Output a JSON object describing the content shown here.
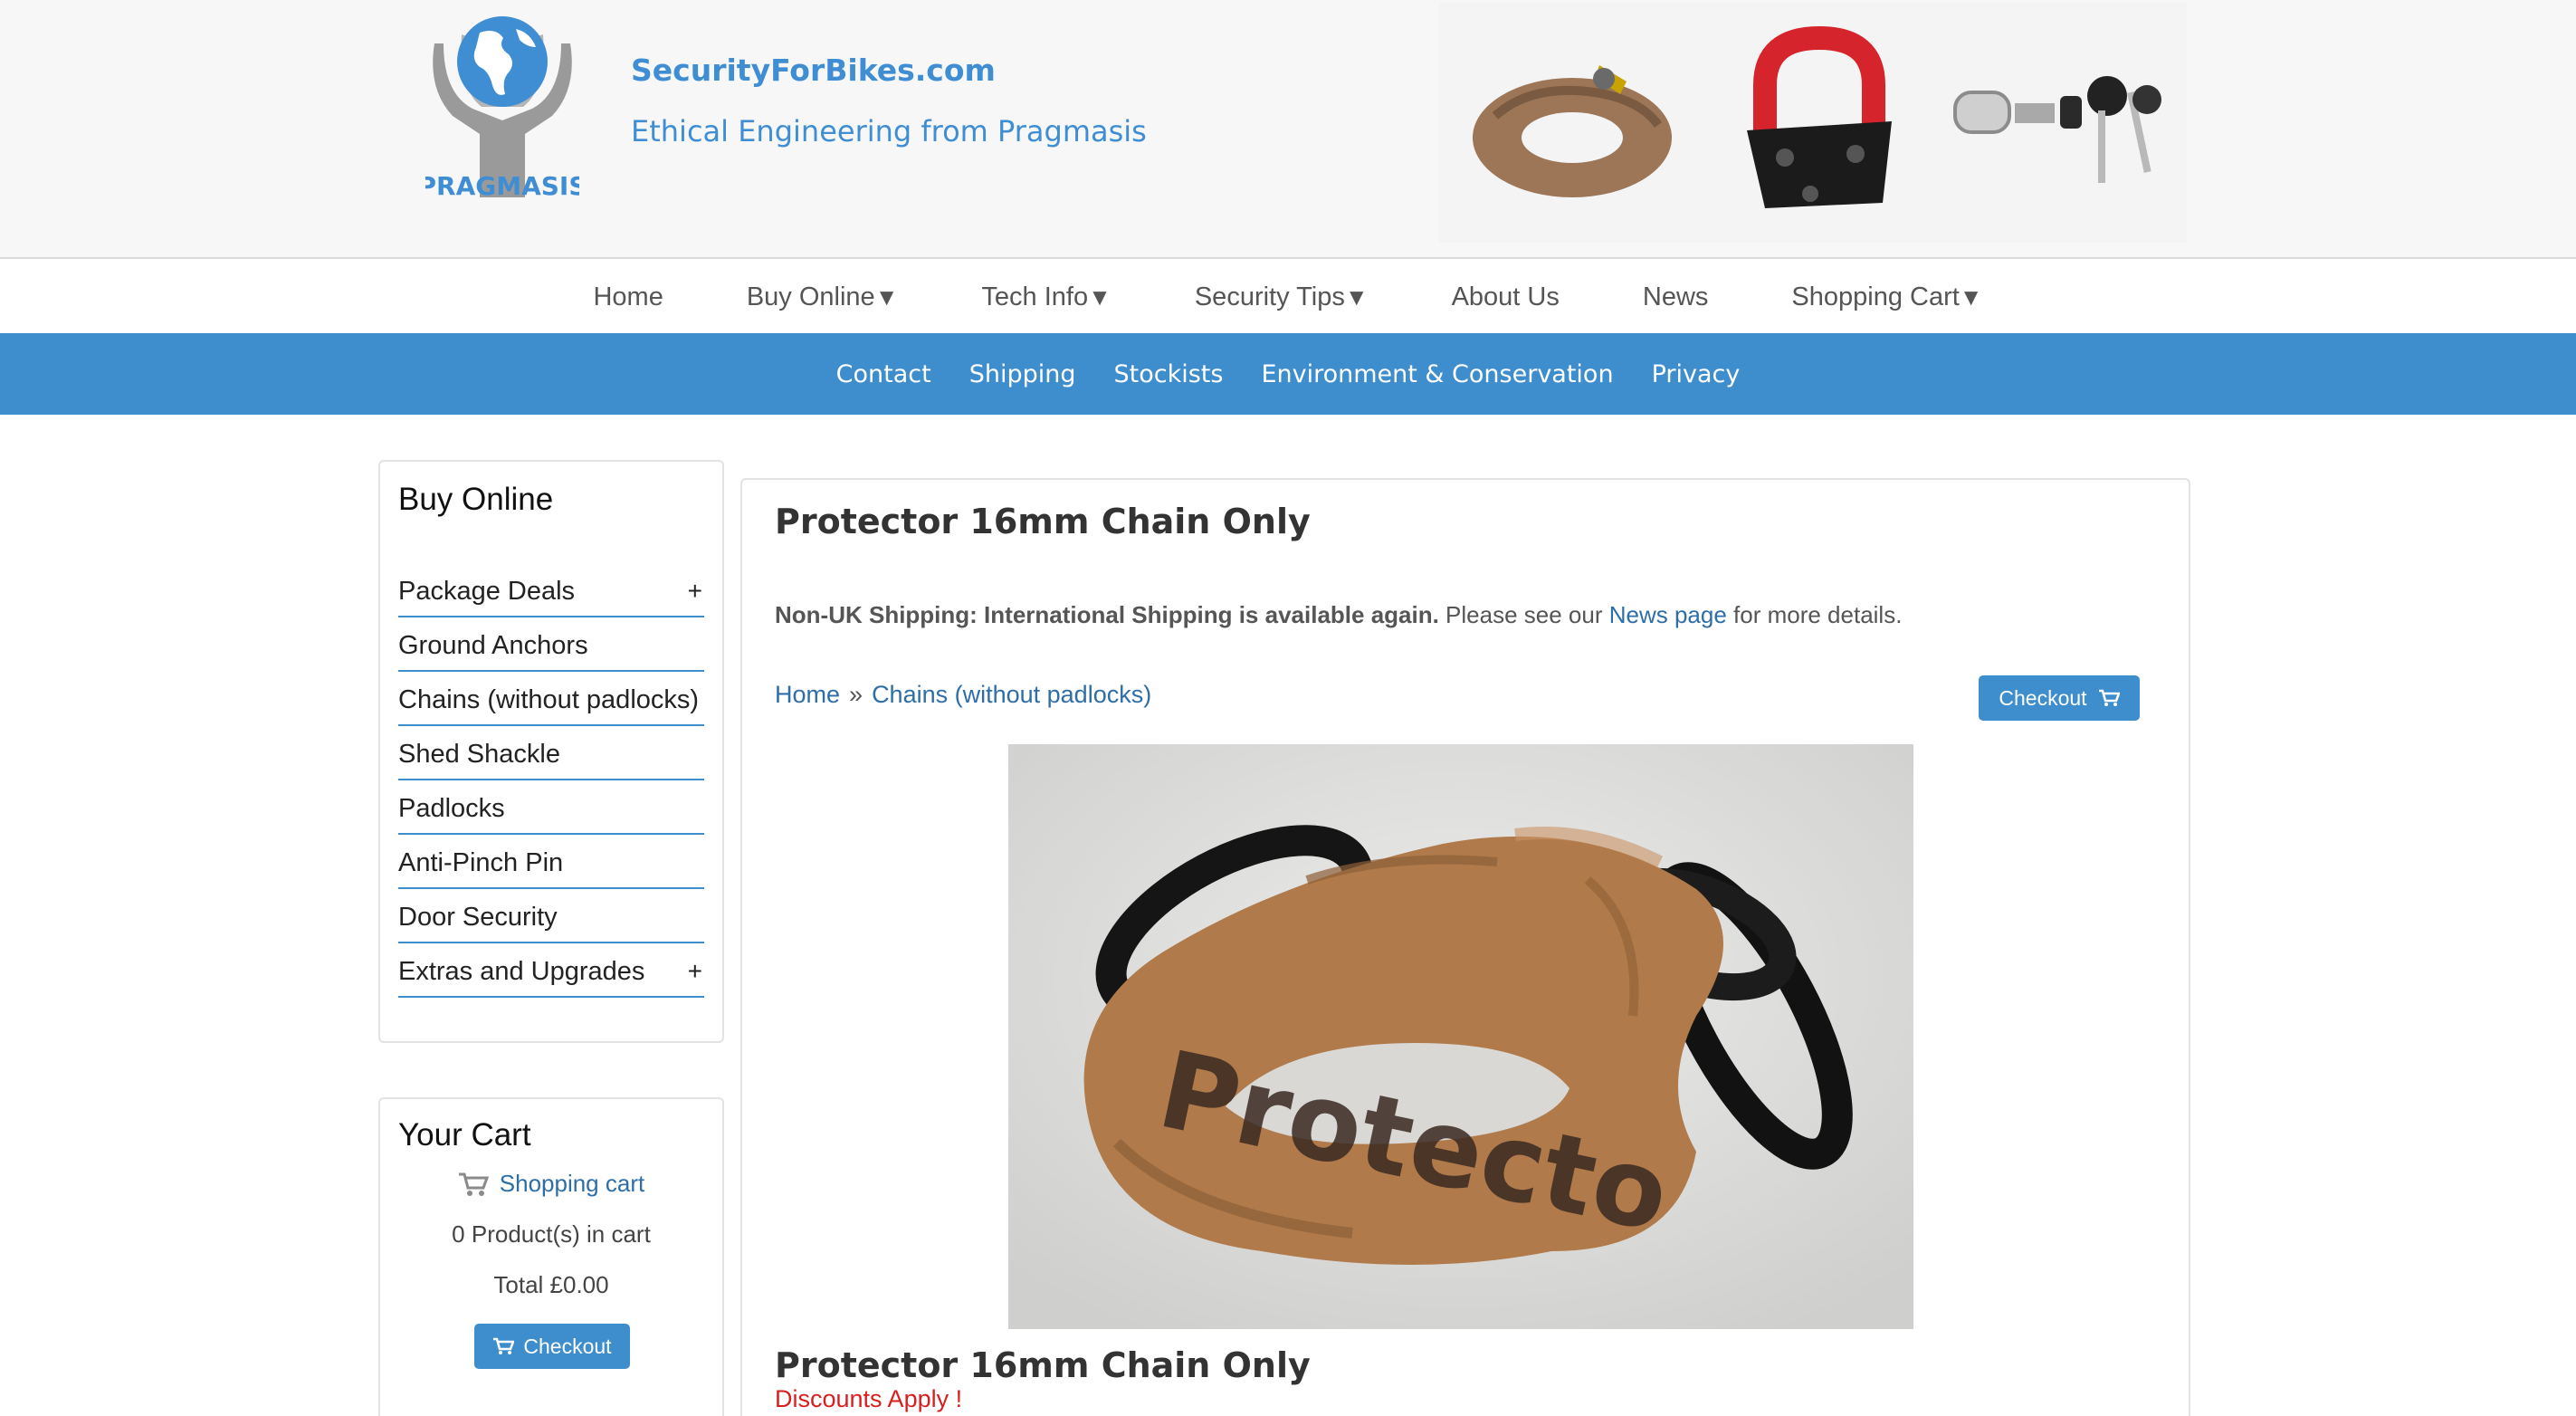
{
  "header": {
    "site_name": "SecurityForBikes.com",
    "tagline": "Ethical Engineering from Pragmasis",
    "logo_text": "PRAGMASIS"
  },
  "main_nav": [
    {
      "label": "Home",
      "dropdown": false
    },
    {
      "label": "Buy Online",
      "dropdown": true
    },
    {
      "label": "Tech Info",
      "dropdown": true
    },
    {
      "label": "Security Tips",
      "dropdown": true
    },
    {
      "label": "About Us",
      "dropdown": false
    },
    {
      "label": "News",
      "dropdown": false
    },
    {
      "label": "Shopping Cart",
      "dropdown": true
    }
  ],
  "dropdown_caret": "▼",
  "sub_nav": [
    "Contact",
    "Shipping",
    "Stockists",
    "Environment & Conservation",
    "Privacy"
  ],
  "sidebar": {
    "buy_title": "Buy Online",
    "categories": [
      {
        "label": "Package Deals",
        "expand": "+"
      },
      {
        "label": "Ground Anchors",
        "expand": ""
      },
      {
        "label": "Chains (without padlocks)",
        "expand": ""
      },
      {
        "label": "Shed Shackle",
        "expand": ""
      },
      {
        "label": "Padlocks",
        "expand": ""
      },
      {
        "label": "Anti-Pinch Pin",
        "expand": ""
      },
      {
        "label": "Door Security",
        "expand": ""
      },
      {
        "label": "Extras and Upgrades",
        "expand": "+"
      }
    ],
    "cart": {
      "title": "Your Cart",
      "link": "Shopping cart",
      "count": "0 Product(s) in cart",
      "total": "Total £0.00",
      "checkout": "Checkout"
    }
  },
  "main": {
    "title": "Protector 16mm Chain Only",
    "notice_bold": "Non-UK Shipping: International Shipping is available again.",
    "notice_text": " Please see our ",
    "notice_link": "News page",
    "notice_tail": " for more details.",
    "breadcrumb": {
      "home": "Home",
      "separator": "»",
      "current": "Chains (without padlocks)"
    },
    "checkout": "Checkout",
    "image_text": "Protecto",
    "product_name": "Protector 16mm Chain Only",
    "discount": "Discounts Apply !"
  },
  "colors": {
    "brand_blue": "#3e8dcc",
    "link_blue": "#2e6ea8",
    "discount_red": "#d81e1e",
    "chain_sleeve": "#b07a4a"
  }
}
